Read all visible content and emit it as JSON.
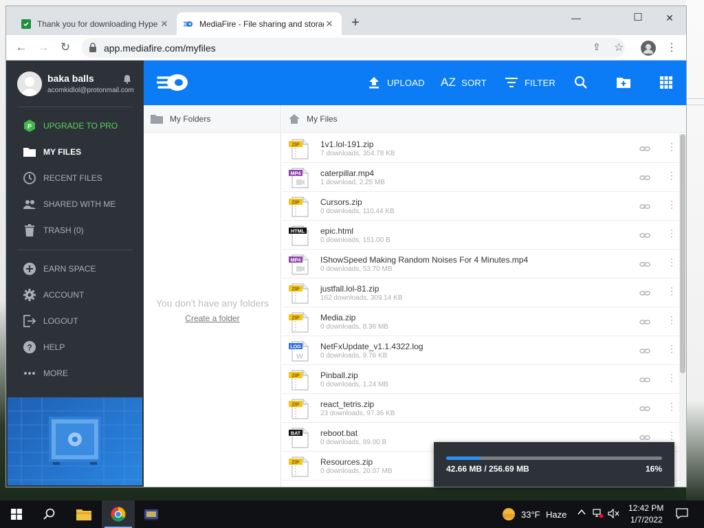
{
  "browser": {
    "tabs": [
      {
        "title": "Thank you for downloading Hype",
        "close": "✕",
        "favicon_color": "#1e8e3e"
      },
      {
        "title": "MediaFire - File sharing and storage",
        "close": "✕",
        "favicon_color": "#1a73e8"
      }
    ],
    "new_tab": "+",
    "window_controls": {
      "minimize": "—",
      "maximize": "☐",
      "close": "✕"
    },
    "url": "app.mediafire.com/myfiles",
    "back": "←",
    "forward": "→",
    "reload": "↻",
    "star": "☆",
    "share": "⇪",
    "menu": "⋮"
  },
  "user": {
    "name": "baka balls",
    "email": "acomkidlol@protonmail.com"
  },
  "sidebar": {
    "items": [
      {
        "label": "UPGRADE TO PRO",
        "icon": "upgrade-icon",
        "color": "#5bd35b"
      },
      {
        "label": "MY FILES",
        "icon": "folder-icon",
        "color": "#ffffff"
      },
      {
        "label": "RECENT FILES",
        "icon": "clock-icon",
        "color": "#aab0b8"
      },
      {
        "label": "SHARED WITH ME",
        "icon": "people-icon",
        "color": "#aab0b8"
      },
      {
        "label": "TRASH (0)",
        "icon": "trash-icon",
        "color": "#aab0b8"
      },
      {
        "label": "EARN SPACE",
        "icon": "plus-circle-icon",
        "color": "#aab0b8"
      },
      {
        "label": "ACCOUNT",
        "icon": "gear-icon",
        "color": "#aab0b8"
      },
      {
        "label": "LOGOUT",
        "icon": "logout-icon",
        "color": "#aab0b8"
      },
      {
        "label": "HELP",
        "icon": "help-icon",
        "color": "#aab0b8"
      },
      {
        "label": "MORE",
        "icon": "dots-icon",
        "color": "#aab0b8"
      }
    ]
  },
  "topbar": {
    "upload": "UPLOAD",
    "sort": "SORT",
    "filter": "FILTER",
    "sort_glyph": "AZ",
    "accent": "#0b7cf6"
  },
  "folders": {
    "header": "My Folders",
    "empty": "You don't have any folders",
    "create": "Create a folder"
  },
  "files": {
    "header": "My Files",
    "list": [
      {
        "name": "1v1.lol-191.zip",
        "meta": "7 downloads, 354.78 KB",
        "type": "ZIP"
      },
      {
        "name": "caterpillar.mp4",
        "meta": "1 download, 2.25 MB",
        "type": "MP4"
      },
      {
        "name": "Cursors.zip",
        "meta": "0 downloads, 110.44 KB",
        "type": "ZIP"
      },
      {
        "name": "epic.html",
        "meta": "0 downloads, 151.00 B",
        "type": "HTML"
      },
      {
        "name": "IShowSpeed Making Random Noises For 4 Minutes.mp4",
        "meta": "0 downloads, 53.70 MB",
        "type": "MP4"
      },
      {
        "name": "justfall.lol-81.zip",
        "meta": "162 downloads, 309.14 KB",
        "type": "ZIP"
      },
      {
        "name": "Media.zip",
        "meta": "0 downloads, 8.36 MB",
        "type": "ZIP"
      },
      {
        "name": "NetFxUpdate_v1.1.4322.log",
        "meta": "0 downloads, 9.76 KB",
        "type": "LOG"
      },
      {
        "name": "Pinball.zip",
        "meta": "0 downloads, 1.24 MB",
        "type": "ZIP"
      },
      {
        "name": "react_tetris.zip",
        "meta": "23 downloads, 97.36 KB",
        "type": "ZIP"
      },
      {
        "name": "reboot.bat",
        "meta": "0 downloads, 89.00 B",
        "type": "BAT"
      },
      {
        "name": "Resources.zip",
        "meta": "0 downloads, 20.07 MB",
        "type": "ZIP"
      }
    ]
  },
  "upload_progress": {
    "size_text": "42.66 MB / 256.69 MB",
    "percent_text": "16%",
    "fraction": 0.16
  },
  "taskbar": {
    "weather_temp": "33°F",
    "weather_desc": "Haze",
    "time": "12:42 PM",
    "date": "1/7/2022"
  }
}
